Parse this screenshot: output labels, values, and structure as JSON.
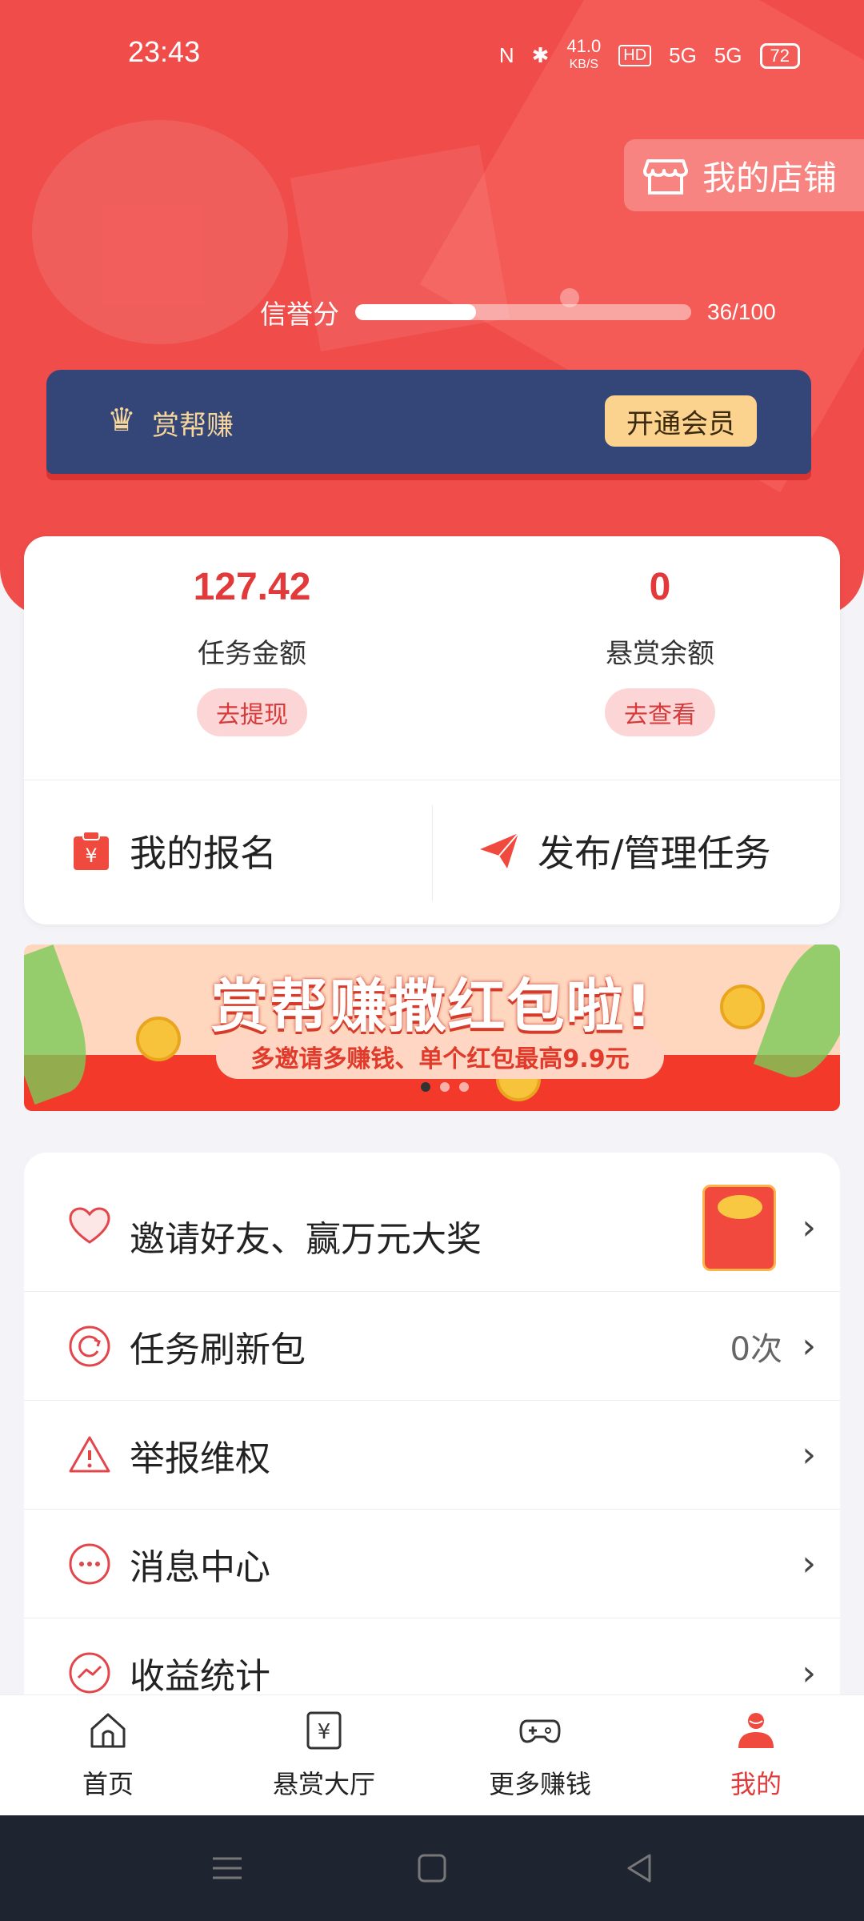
{
  "status_bar": {
    "time": "23:43",
    "speed": "41.0",
    "speed_unit": "KB/S",
    "hd": "HD",
    "net1": "5G",
    "net2": "5G",
    "battery": "72"
  },
  "header": {
    "shop_label": "我的店铺",
    "credit_label": "信誉分",
    "credit_value": "36/100",
    "credit_fraction": 0.36,
    "vip_name": "赏帮赚",
    "vip_button": "开通会员"
  },
  "money": {
    "task_amount": "127.42",
    "task_label": "任务金额",
    "task_action": "去提现",
    "reward_amount": "0",
    "reward_label": "悬赏余额",
    "reward_action": "去查看"
  },
  "actions": {
    "my_signup": "我的报名",
    "publish_manage": "发布/管理任务"
  },
  "banner": {
    "title": "赏帮赚撒红包啦!",
    "subtitle": "多邀请多赚钱、单个红包最高9.9元"
  },
  "menu": [
    {
      "label": "邀请好友、赢万元大奖",
      "icon": "heart-icon",
      "extra": ""
    },
    {
      "label": "任务刷新包",
      "icon": "refresh-icon",
      "extra": "0次"
    },
    {
      "label": "举报维权",
      "icon": "warning-icon",
      "extra": ""
    },
    {
      "label": "消息中心",
      "icon": "message-icon",
      "extra": ""
    },
    {
      "label": "收益统计",
      "icon": "chart-icon",
      "extra": ""
    }
  ],
  "tabs": [
    {
      "label": "首页",
      "icon": "home-icon"
    },
    {
      "label": "悬赏大厅",
      "icon": "yuan-icon"
    },
    {
      "label": "更多赚钱",
      "icon": "gamepad-icon"
    },
    {
      "label": "我的",
      "icon": "profile-icon"
    }
  ],
  "colors": {
    "accent": "#ef4c4a",
    "vip_bg": "#344577",
    "vip_gold": "#fbd28e"
  }
}
